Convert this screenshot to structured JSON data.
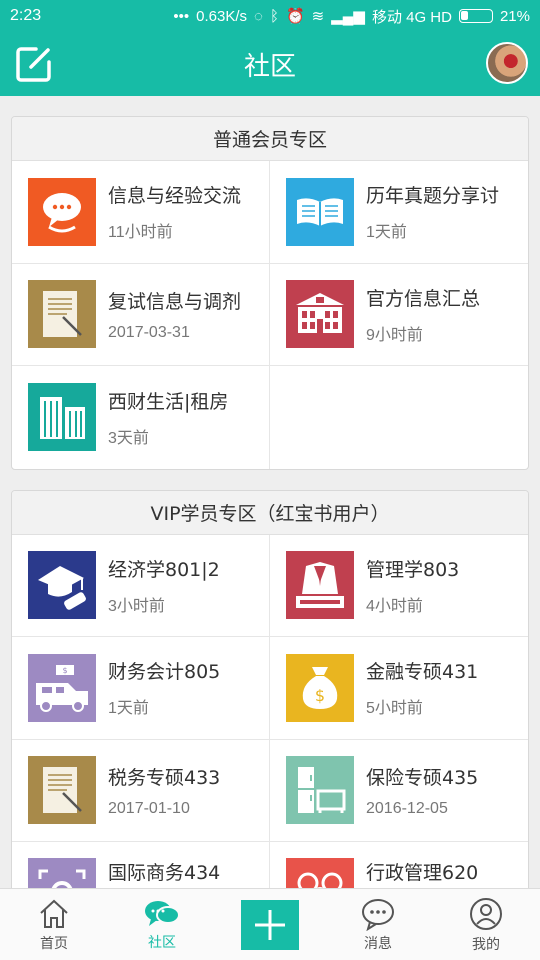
{
  "status_bar": {
    "time": "2:23",
    "network_speed": "0.63K/s",
    "carrier": "移动 4G HD",
    "battery": "21%"
  },
  "header": {
    "title": "社区",
    "compose_icon": "compose-icon",
    "avatar": "user-avatar"
  },
  "sections": [
    {
      "title": "普通会员专区",
      "items": [
        {
          "name": "信息与经验交流",
          "time": "11小时前",
          "icon": "chat-cup-icon",
          "color": "#f05a23"
        },
        {
          "name": "历年真题分享讨",
          "time": "1天前",
          "icon": "open-book-icon",
          "color": "#2faadf"
        },
        {
          "name": "复试信息与调剂",
          "time": "2017-03-31",
          "icon": "document-pen-icon",
          "color": "#a88a4a"
        },
        {
          "name": "官方信息汇总",
          "time": "9小时前",
          "icon": "building-icon",
          "color": "#c0404f"
        },
        {
          "name": "西财生活|租房",
          "time": "3天前",
          "icon": "city-buildings-icon",
          "color": "#16a99b"
        }
      ]
    },
    {
      "title": "VIP学员专区（红宝书用户）",
      "items": [
        {
          "name": "经济学801|2",
          "time": "3小时前",
          "icon": "graduation-cap-icon",
          "color": "#2b3a8c"
        },
        {
          "name": "管理学803",
          "time": "4小时前",
          "icon": "suit-icon",
          "color": "#c0404f"
        },
        {
          "name": "财务会计805",
          "time": "1天前",
          "icon": "truck-money-icon",
          "color": "#9d8ac2"
        },
        {
          "name": "金融专硕431",
          "time": "5小时前",
          "icon": "money-bag-icon",
          "color": "#e9b520"
        },
        {
          "name": "税务专硕433",
          "time": "2017-01-10",
          "icon": "document-pen-icon",
          "color": "#a88a4a"
        },
        {
          "name": "保险专硕435",
          "time": "2016-12-05",
          "icon": "furniture-icon",
          "color": "#7fc4ae"
        },
        {
          "name": "国际商务434",
          "time": "",
          "icon": "gear-frame-icon",
          "color": "#9d8ac2"
        },
        {
          "name": "行政管理620",
          "time": "",
          "icon": "people-icon",
          "color": "#e8534a"
        }
      ]
    }
  ],
  "tabs": [
    {
      "label": "首页",
      "icon": "home-icon"
    },
    {
      "label": "社区",
      "icon": "community-chat-icon",
      "active": true
    },
    {
      "label": "",
      "icon": "plus-icon"
    },
    {
      "label": "消息",
      "icon": "message-icon"
    },
    {
      "label": "我的",
      "icon": "profile-icon"
    }
  ]
}
